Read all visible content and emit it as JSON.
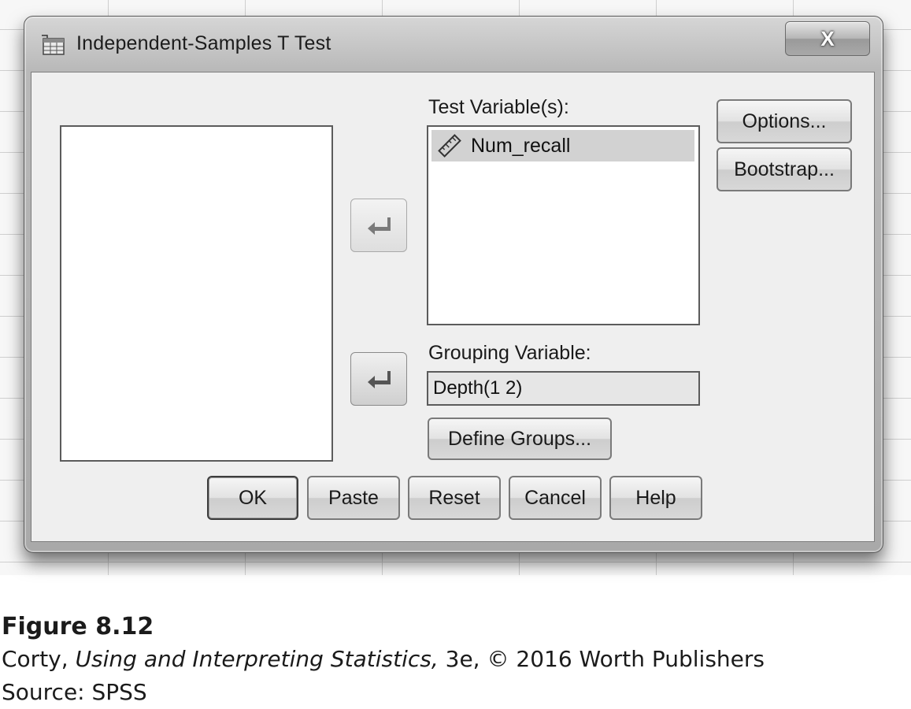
{
  "window": {
    "title": "Independent-Samples T Test",
    "close_glyph": "X"
  },
  "labels": {
    "test_variables": "Test Variable(s):",
    "grouping_variable": "Grouping Variable:"
  },
  "test_variables": [
    {
      "name": "Num_recall",
      "icon": "scale-ruler-icon"
    }
  ],
  "grouping_value": "Depth(1 2)",
  "buttons": {
    "options": "Options...",
    "bootstrap": "Bootstrap...",
    "define_groups": "Define Groups...",
    "ok": "OK",
    "paste": "Paste",
    "reset": "Reset",
    "cancel": "Cancel",
    "help": "Help"
  },
  "caption": {
    "figure": "Figure 8.12",
    "author": "Corty,",
    "book": "Using and Interpreting Statistics,",
    "edition": "3e, © 2016 Worth Publishers",
    "source": "Source: SPSS"
  }
}
